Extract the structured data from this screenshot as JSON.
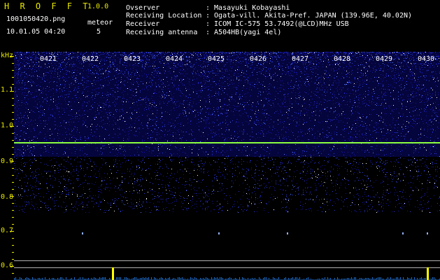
{
  "app": {
    "title": "H R O F F T",
    "version": "1.0.0"
  },
  "file": {
    "name": "1001050420.png",
    "datetime": "10.01.05 04:20"
  },
  "meteor": {
    "label": "meteor",
    "count": "5"
  },
  "info": [
    {
      "label": "Ovserver",
      "value": ": Masayuki Kobayashi"
    },
    {
      "label": "Receiving Location",
      "value": ": Ogata-vill. Akita-Pref. JAPAN (139.96E, 40.02N)"
    },
    {
      "label": "Receiver",
      "value": ": ICOM IC-575 53.7492(@LCD)MHz USB"
    },
    {
      "label": "Receiving antenna",
      "value": ": A504HB(yagi 4el)"
    }
  ],
  "axis": {
    "unit": "kHz",
    "labels": [
      "1.1",
      "1.0",
      "0.9",
      "0.8",
      "0.7",
      "0.6"
    ]
  },
  "times": [
    "0421",
    "0422",
    "0423",
    "0424",
    "0425",
    "0426",
    "0427",
    "0428",
    "0429",
    "0430"
  ],
  "colors": {
    "label": "#e8e800",
    "carrier": "#8cff40",
    "noise": "#1010a0",
    "meteor": "#ffff00"
  }
}
